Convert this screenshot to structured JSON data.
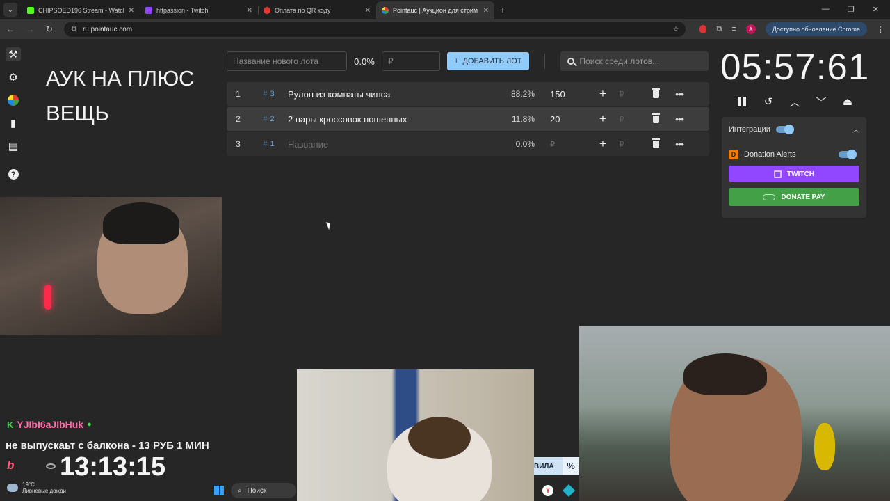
{
  "browser": {
    "tabs": [
      {
        "title": "CHIPSOED196 Stream - Watch",
        "color": "#53fc18",
        "active": false
      },
      {
        "title": "httpassion - Twitch",
        "color": "#9146ff",
        "active": false
      },
      {
        "title": "Оплата по QR коду",
        "color": "#e53935",
        "active": false
      },
      {
        "title": "Pointauc | Аукцион для стрим",
        "color": "#fdd835",
        "active": true
      }
    ],
    "url": "ru.pointauc.com",
    "update_label": "Доступно обновление Chrome",
    "avatar_letter": "A"
  },
  "overlay_title": "АУК НА ПЛЮС ВЕЩЬ",
  "add_lot": {
    "name_placeholder": "Название нового лота",
    "percent": "0.0%",
    "amount_placeholder": "₽",
    "add_label": "ДОБАВИТЬ ЛОТ",
    "search_placeholder": "Поиск среди лотов..."
  },
  "lots": [
    {
      "index": "1",
      "fast_id": "3",
      "name": "Рулон из комнаты чипса",
      "percent": "88.2%",
      "amount": "150",
      "placeholder": false
    },
    {
      "index": "2",
      "fast_id": "2",
      "name": "2 пары кроссовок ношенных",
      "percent": "11.8%",
      "amount": "20",
      "placeholder": false
    },
    {
      "index": "3",
      "fast_id": "1",
      "name": "Название",
      "percent": "0.0%",
      "amount": "₽",
      "placeholder": true
    }
  ],
  "rub_symbol": "₽",
  "timer": "05:57:61",
  "integrations": {
    "label": "Интеграции",
    "donation_alerts": "Donation Alerts",
    "twitch": "TWITCH",
    "donate_pay": "DONATE PAY"
  },
  "chat": {
    "username": "YJIbI6aJIbHuk",
    "message": "не выпускаьт с балкона - 13 РУБ 1 МИН",
    "clock": "13:13:15"
  },
  "overlay_tag": {
    "text": "ВИЛА",
    "percent": "%"
  },
  "taskbar": {
    "temp": "19°C",
    "weather": "Ливневые дожди",
    "search": "Поиск"
  }
}
